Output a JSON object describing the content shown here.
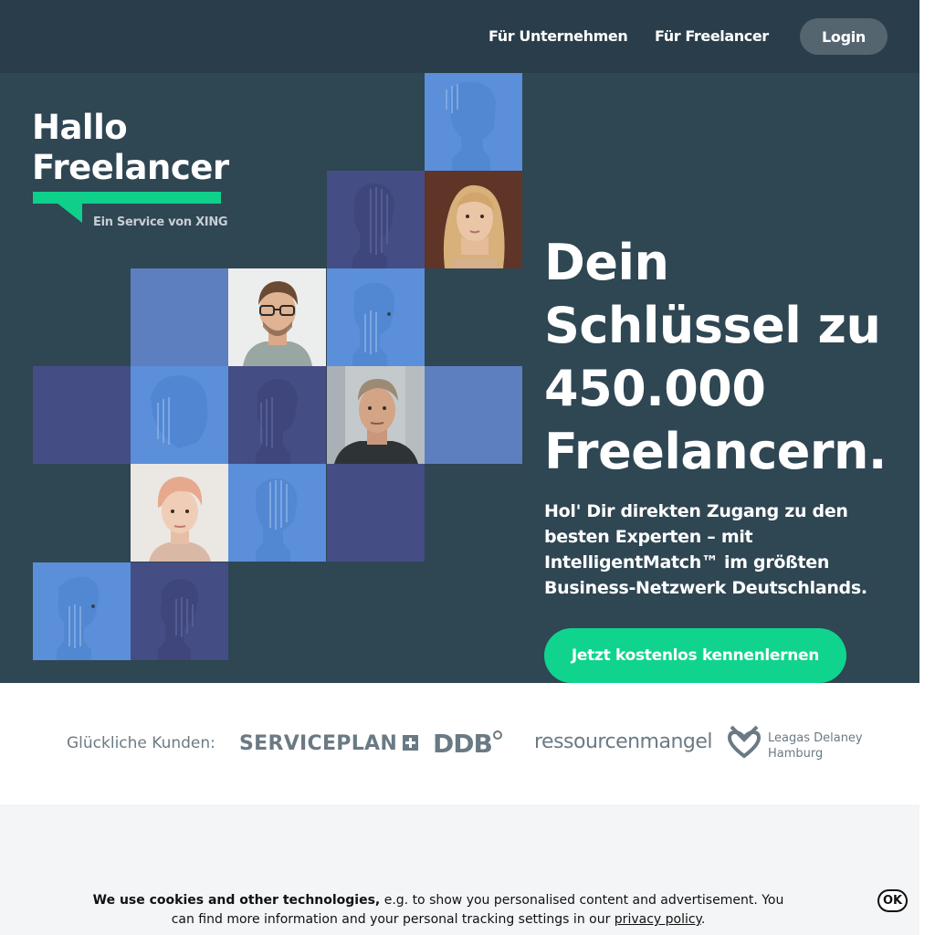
{
  "header": {
    "nav": [
      {
        "label": "Für Unternehmen"
      },
      {
        "label": "Für Freelancer"
      }
    ],
    "login_label": "Login"
  },
  "logo": {
    "line1": "Hallo",
    "line2": "Freelancer",
    "tagline": "Ein Service von XING",
    "accent_color": "#0ed08b"
  },
  "hero": {
    "headline_lines": [
      "Dein",
      "Schlüssel zu",
      "450.000",
      "Freelancern."
    ],
    "subline": "Hol' Dir direkten Zugang zu den besten Experten – mit IntelligentMatch™ im größten Business-Netzwerk Deutschlands.",
    "cta_label": "Jetzt kostenlos kennenlernen",
    "colors": {
      "background": "#2f4653",
      "cta": "#10d48e"
    }
  },
  "customers": {
    "label": "Glückliche Kunden:",
    "brands": {
      "serviceplan": "SERVICEPLAN",
      "ddb": "DDB",
      "ressourcenmangel": "ressourcenmangel",
      "leagas_line1": "Leagas Delaney",
      "leagas_line2": "Hamburg"
    }
  },
  "cookie": {
    "bold": "We use cookies and other technologies,",
    "text": " e.g. to show you personalised content and advertisement. You can find more information and your personal tracking settings in our ",
    "link": "privacy policy",
    "end": ".",
    "ok_label": "OK"
  }
}
